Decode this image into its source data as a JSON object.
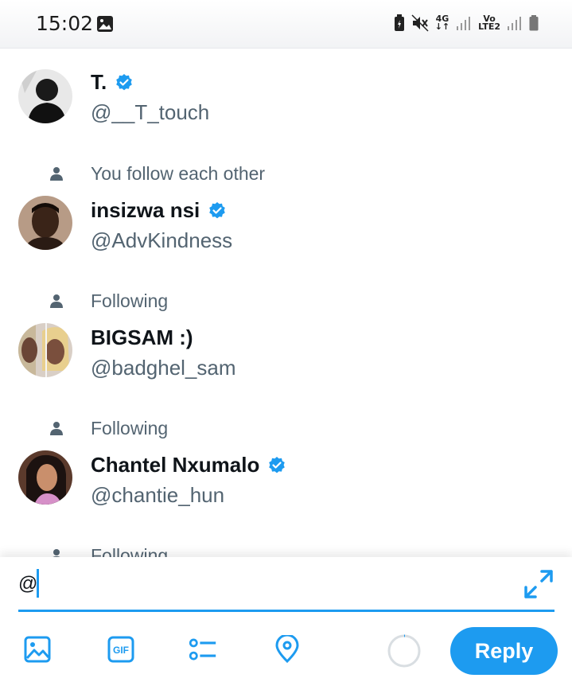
{
  "status_bar": {
    "time": "15:02",
    "network": "4G",
    "volte": "Vo",
    "lte": "LTE2"
  },
  "suggestions": [
    {
      "social": "",
      "name": "T.",
      "handle": "@__T_touch",
      "verified": true
    },
    {
      "social": "You follow each other",
      "name": "insizwa nsi",
      "handle": "@AdvKindness",
      "verified": true
    },
    {
      "social": "Following",
      "name": "BIGSAM :)",
      "handle": "@badghel_sam",
      "verified": false
    },
    {
      "social": "Following",
      "name": "Chantel Nxumalo",
      "handle": "@chantie_hun",
      "verified": true
    },
    {
      "social": "Following",
      "name": "",
      "handle": "",
      "verified": false
    }
  ],
  "compose": {
    "text": "@",
    "reply_label": "Reply"
  },
  "colors": {
    "accent": "#1d9bf0",
    "secondary_text": "#536471"
  }
}
